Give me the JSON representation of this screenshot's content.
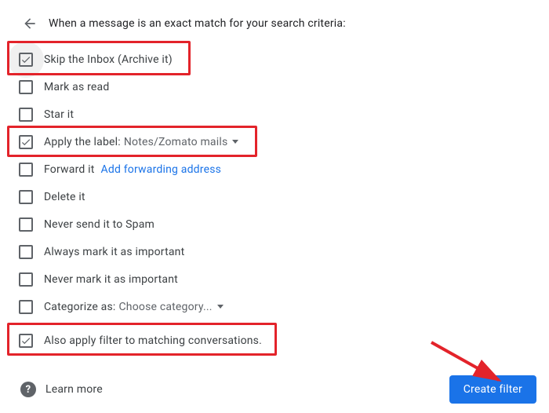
{
  "header": {
    "title": "When a message is an exact match for your search criteria:"
  },
  "options": {
    "skip_inbox": {
      "label": "Skip the Inbox (Archive it)",
      "checked": true
    },
    "mark_read": {
      "label": "Mark as read",
      "checked": false
    },
    "star": {
      "label": "Star it",
      "checked": false
    },
    "apply_label": {
      "label": "Apply the label:",
      "value": "Notes/Zomato mails",
      "checked": true
    },
    "forward": {
      "label": "Forward it",
      "link": "Add forwarding address",
      "checked": false
    },
    "delete": {
      "label": "Delete it",
      "checked": false
    },
    "never_spam": {
      "label": "Never send it to Spam",
      "checked": false
    },
    "always_important": {
      "label": "Always mark it as important",
      "checked": false
    },
    "never_important": {
      "label": "Never mark it as important",
      "checked": false
    },
    "categorize": {
      "label": "Categorize as:",
      "value": "Choose category...",
      "checked": false
    },
    "also_apply": {
      "label": "Also apply filter to matching conversations.",
      "checked": true
    }
  },
  "footer": {
    "learn_more": "Learn more",
    "create_button": "Create filter"
  }
}
